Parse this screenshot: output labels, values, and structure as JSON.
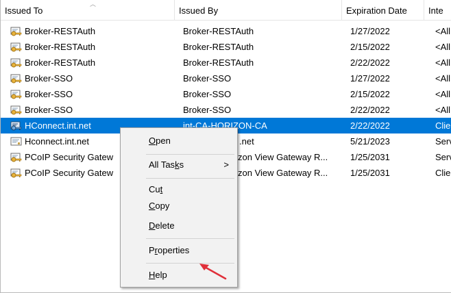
{
  "columns": [
    "Issued To",
    "Issued By",
    "Expiration Date",
    "Inte"
  ],
  "rows": [
    {
      "issued_to": "Broker-RESTAuth",
      "issued_by": "Broker-RESTAuth",
      "expiration": "1/27/2022",
      "intended": "<All"
    },
    {
      "issued_to": "Broker-RESTAuth",
      "issued_by": "Broker-RESTAuth",
      "expiration": "2/15/2022",
      "intended": "<All"
    },
    {
      "issued_to": "Broker-RESTAuth",
      "issued_by": "Broker-RESTAuth",
      "expiration": "2/22/2022",
      "intended": "<All"
    },
    {
      "issued_to": "Broker-SSO",
      "issued_by": "Broker-SSO",
      "expiration": "1/27/2022",
      "intended": "<All"
    },
    {
      "issued_to": "Broker-SSO",
      "issued_by": "Broker-SSO",
      "expiration": "2/15/2022",
      "intended": "<All"
    },
    {
      "issued_to": "Broker-SSO",
      "issued_by": "Broker-SSO",
      "expiration": "2/22/2022",
      "intended": "<All"
    },
    {
      "issued_to": "HConnect.int.net",
      "issued_by": "int-CA-HORIZON-CA",
      "expiration": "2/22/2022",
      "intended": "Clie",
      "selected": true
    },
    {
      "issued_to": "Hconnect.int.net",
      "issued_by": ".net",
      "expiration": "5/21/2023",
      "intended": "Serv"
    },
    {
      "issued_to": "PCoIP Security Gatew",
      "issued_by": "zon View Gateway R...",
      "expiration": "1/25/2031",
      "intended": "Serv"
    },
    {
      "issued_to": "PCoIP Security Gatew",
      "issued_by": "zon View Gateway R...",
      "expiration": "1/25/2031",
      "intended": "Clie"
    }
  ],
  "context_menu": {
    "open": {
      "pre": "",
      "key": "O",
      "post": "pen"
    },
    "all_tasks": {
      "pre": "All Tas",
      "key": "k",
      "post": "s"
    },
    "cut": {
      "pre": "Cu",
      "key": "t",
      "post": ""
    },
    "copy": {
      "pre": "",
      "key": "C",
      "post": "opy"
    },
    "delete": {
      "pre": "",
      "key": "D",
      "post": "elete"
    },
    "properties": {
      "pre": "P",
      "key": "r",
      "post": "operties"
    },
    "help": {
      "pre": "",
      "key": "H",
      "post": "elp"
    },
    "submenu_arrow": ">"
  },
  "colors": {
    "selection": "#0078d7",
    "menu_background": "#f2f2f2",
    "pointer_arrow": "#e0303a"
  },
  "icons": {
    "certificate": "certificate-icon",
    "certificate_with_key": "certificate-key-icon"
  }
}
